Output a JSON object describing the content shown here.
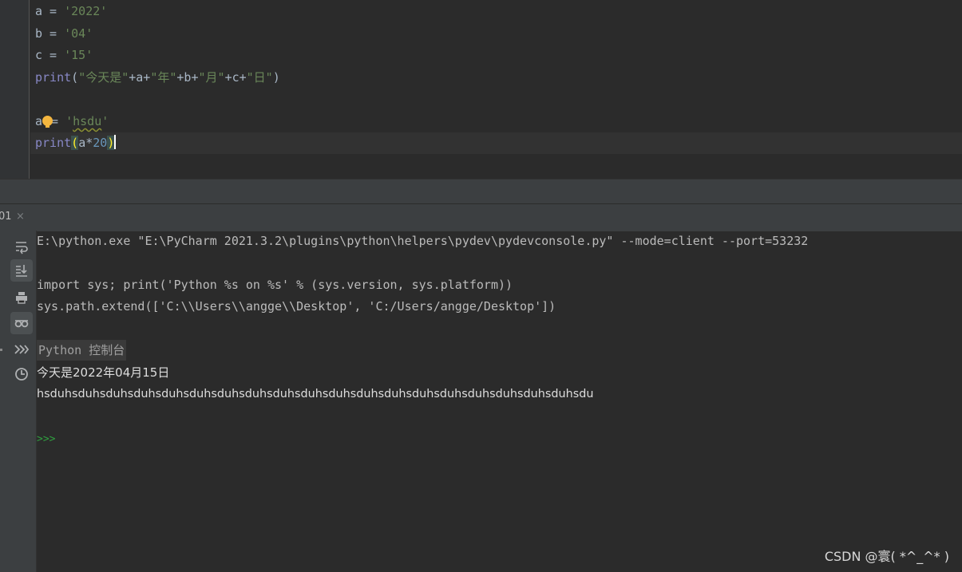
{
  "editor": {
    "line1": {
      "var": "a",
      "op": " = ",
      "str": "'2022'"
    },
    "line2": {
      "var": "b",
      "op": " = ",
      "str": "'04'"
    },
    "line3": {
      "var": "c",
      "op": " = ",
      "str": "'15'"
    },
    "line4": {
      "fn": "print",
      "open": "(",
      "s1": "\"今天是\"",
      "p1": "+a+",
      "s2": "\"年\"",
      "p2": "+b+",
      "s3": "\"月\"",
      "p3": "+c+",
      "s4": "\"日\"",
      "close": ")"
    },
    "line6": {
      "var": "a",
      "op": "= ",
      "str": "'hsdu'"
    },
    "line7": {
      "fn": "print",
      "open": "(",
      "body": "a*",
      "num": "20",
      "close": ")"
    }
  },
  "tab": {
    "name": "01",
    "close": "×"
  },
  "toolbar": {
    "buttons": [
      "soft-wrap-icon",
      "scroll-to-end-icon",
      "print-icon",
      "show-variables-icon",
      "execute-all-icon",
      "history-icon"
    ]
  },
  "console": {
    "cmd": "E:\\python.exe \"E:\\PyCharm 2021.3.2\\plugins\\python\\helpers\\pydev\\pydevconsole.py\" --mode=client --port=53232",
    "import_line": "import sys; print('Python %s on %s' % (sys.version, sys.platform))",
    "path_line": "sys.path.extend(['C:\\\\Users\\\\angge\\\\Desktop', 'C:/Users/angge/Desktop'])",
    "console_label": "Python 控制台",
    "out1": "今天是2022年04月15日",
    "out2": "hsduhsduhsduhsduhsduhsduhsduhsduhsduhsduhsduhsduhsduhsduhsduhsduhsduhsduhsduhsdu",
    "prompt": ">>>"
  },
  "watermark": "CSDN @寰( *^_^* )",
  "colors": {
    "background": "#2b2b2b",
    "string": "#6a8759",
    "builtin": "#8888c6",
    "number": "#6897bb",
    "prompt": "#2f9e3f"
  }
}
